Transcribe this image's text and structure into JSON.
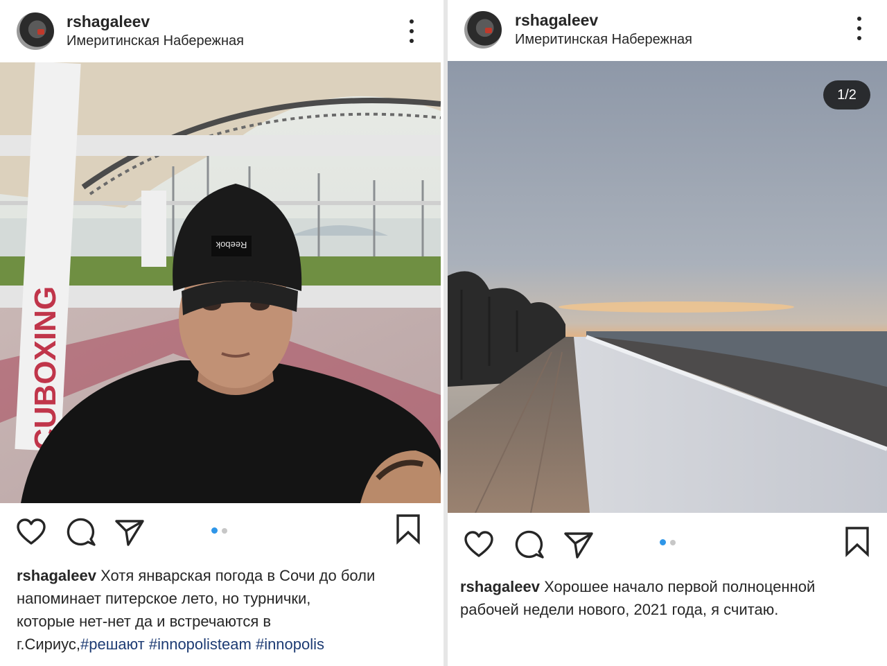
{
  "posts": [
    {
      "username": "rshagaleev",
      "location": "Имеритинская Набережная",
      "carousel_index": 1,
      "carousel_total": 2,
      "caption": {
        "username": "rshagaleev",
        "line1": "Хотя январская погода в Сочи до боли",
        "line2": "напоминает питерское лето, но турнички,",
        "line3": "которые нет-нет да и встречаются в",
        "line4_text": "г.Сириус,",
        "hashtags": [
          "#решают",
          "#innopolisteam",
          "#innopolis"
        ]
      },
      "photo_text": {
        "ring_brand": "CUBOXING",
        "hat_brand": "Reebok"
      }
    },
    {
      "username": "rshagaleev",
      "location": "Имеритинская Набережная",
      "counter": "1/2",
      "carousel_index": 1,
      "carousel_total": 2,
      "caption": {
        "username": "rshagaleev",
        "line1": "Хорошее начало первой полноценной",
        "line2": "рабочей недели нового, 2021 года, я считаю."
      }
    }
  ],
  "colors": {
    "text": "#262626",
    "active_dot": "#2f96e8",
    "inactive_dot": "#c7c7c7",
    "hashtag": "#1d3b73"
  },
  "icons": [
    "heart-icon",
    "comment-icon",
    "share-icon",
    "bookmark-icon",
    "more-icon"
  ]
}
